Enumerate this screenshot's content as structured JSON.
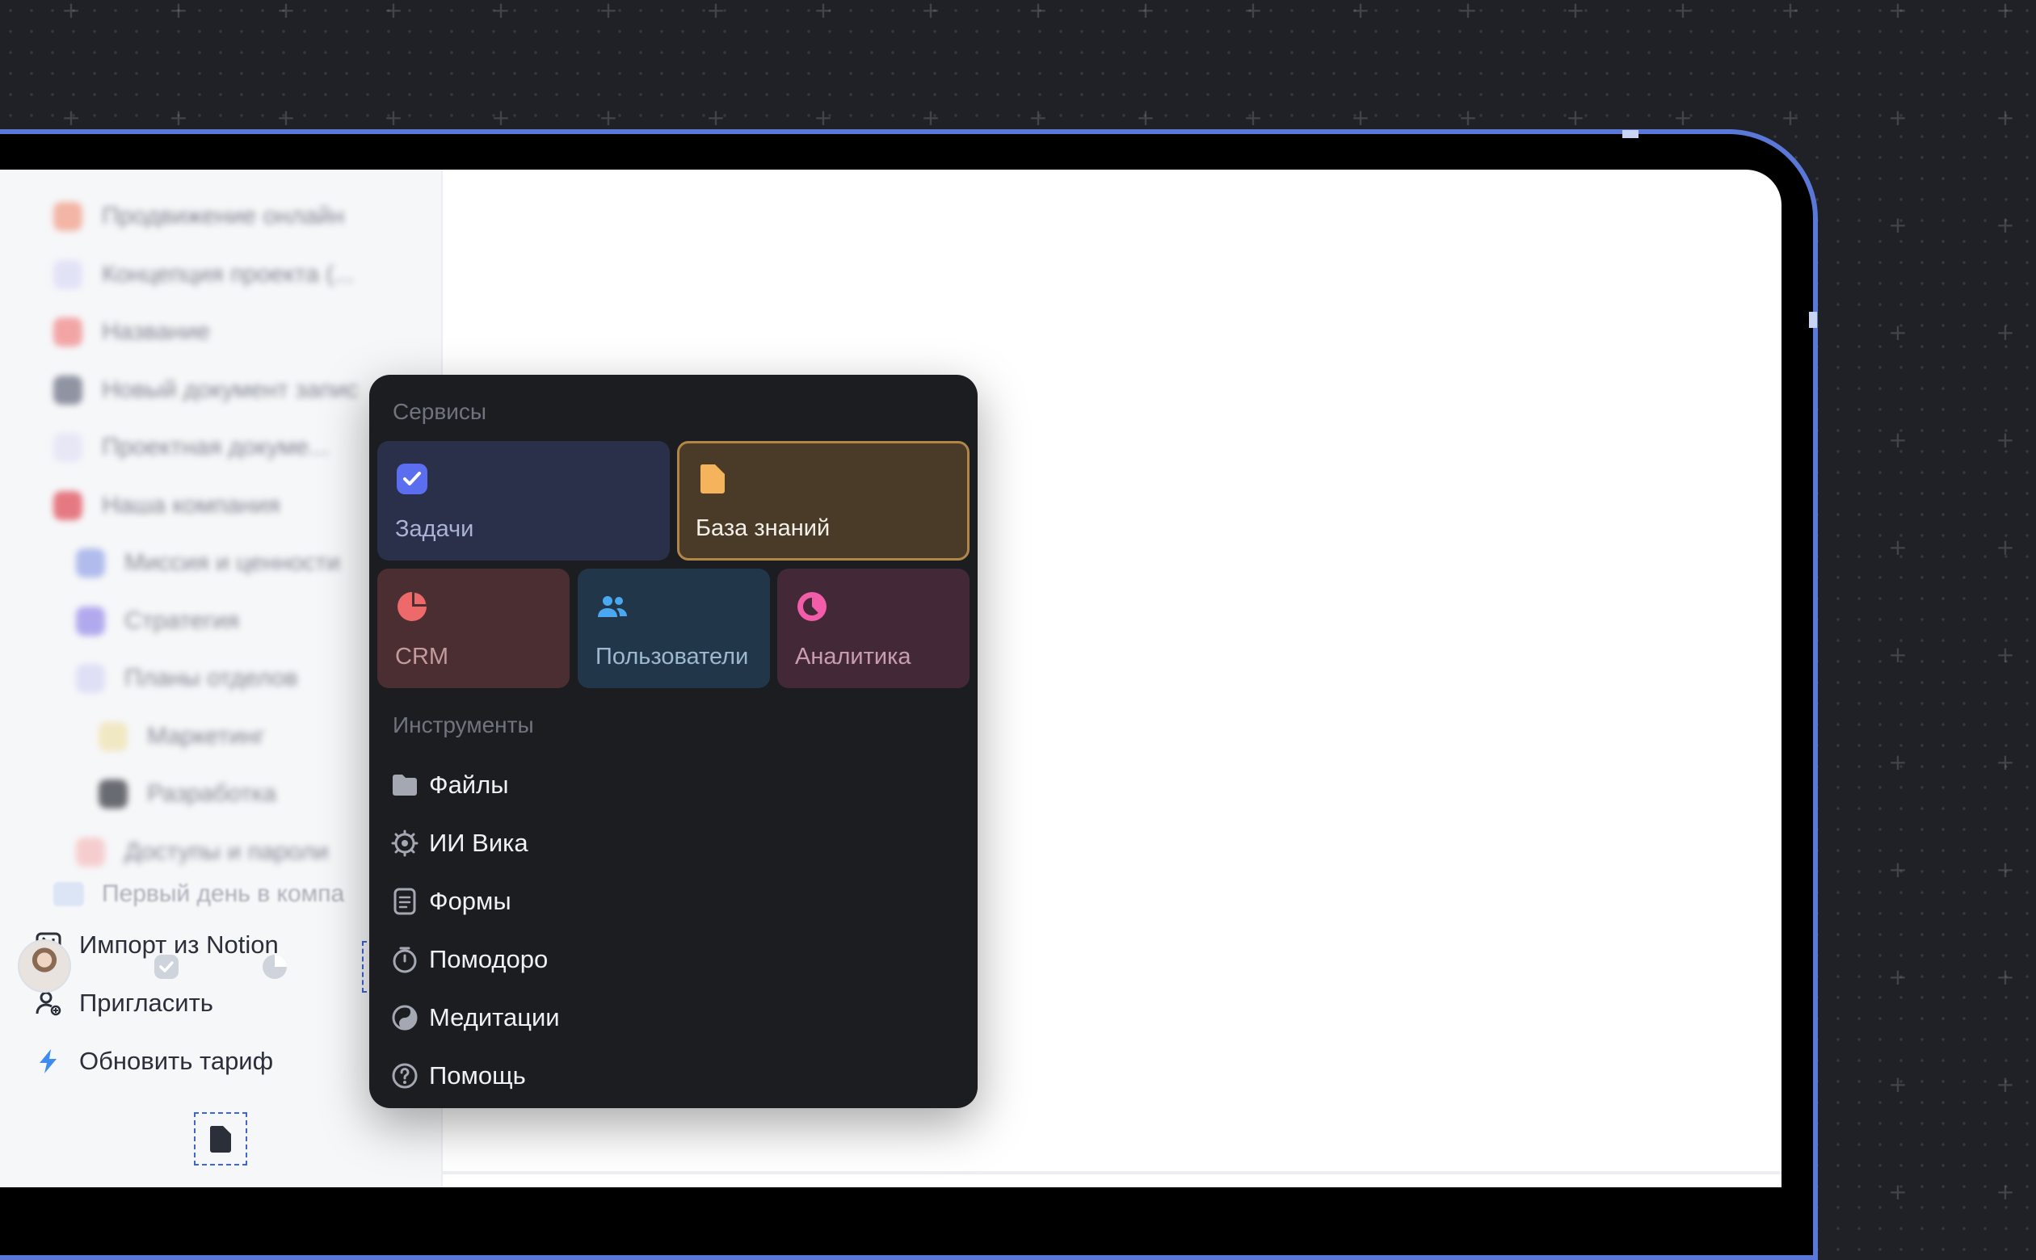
{
  "sidebar": {
    "blurred_items": [
      {
        "label": "Продвижение онлайн",
        "color": "#f2a08a"
      },
      {
        "label": "Концепция проекта (...",
        "color": "#dcdcf6"
      },
      {
        "label": "Название",
        "color": "#f28a8a"
      },
      {
        "label": "Новый документ запис",
        "color": "#6e7385"
      },
      {
        "label": "Проектная докуме...",
        "color": "#e2e2f6"
      },
      {
        "label": "Наша компания",
        "color": "#e0505a"
      },
      {
        "label": "Миссия и ценности",
        "color": "#9aa8e8"
      },
      {
        "label": "Стратегия",
        "color": "#9a90ea"
      },
      {
        "label": "Планы отделов",
        "color": "#d8d8f4"
      },
      {
        "label": "Маркетинг",
        "color": "#efe3b0"
      },
      {
        "label": "Разработка",
        "color": "#3a3d45"
      },
      {
        "label": "Доступы и пароли",
        "color": "#f7c0c0"
      }
    ],
    "first_day": "Первый день в компа",
    "actions": [
      {
        "label": "Импорт из Notion",
        "icon": "notion-icon"
      },
      {
        "label": "Пригласить",
        "icon": "add-user-icon"
      },
      {
        "label": "Обновить тариф",
        "icon": "lightning-icon"
      }
    ]
  },
  "popover": {
    "services_title": "Сервисы",
    "services": [
      {
        "id": "tasks",
        "label": "Задачи",
        "icon": "checkbox-icon",
        "bg": "#2a2f4a",
        "fg": "#aab3d6",
        "accent": "#5b6ef0"
      },
      {
        "id": "kb",
        "label": "База знаний",
        "icon": "document-icon",
        "bg": "#4a3a28",
        "fg": "#f3f0ea",
        "accent": "#f5b45c"
      },
      {
        "id": "crm",
        "label": "CRM",
        "icon": "pie-chart-icon",
        "bg": "#4a2e31",
        "fg": "#c59a9c",
        "accent": "#ee6a6a"
      },
      {
        "id": "users",
        "label": "Пользователи",
        "icon": "users-icon",
        "bg": "#22364a",
        "fg": "#9fb8cf",
        "accent": "#4aa8f0"
      },
      {
        "id": "analytics",
        "label": "Аналитика",
        "icon": "analytics-icon",
        "bg": "#432838",
        "fg": "#c89db2",
        "accent": "#f25ca8"
      }
    ],
    "tools_title": "Инструменты",
    "tools": [
      {
        "label": "Файлы",
        "icon": "folder-icon"
      },
      {
        "label": "ИИ Вика",
        "icon": "ai-gear-icon"
      },
      {
        "label": "Формы",
        "icon": "form-icon"
      },
      {
        "label": "Помодоро",
        "icon": "timer-icon"
      },
      {
        "label": "Медитации",
        "icon": "yin-yang-icon"
      },
      {
        "label": "Помощь",
        "icon": "help-icon"
      }
    ]
  }
}
